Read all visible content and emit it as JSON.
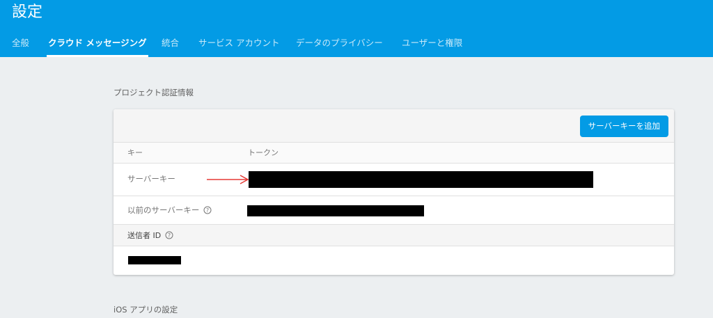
{
  "header": {
    "title": "設定",
    "tabs": [
      {
        "label": "全般",
        "active": false
      },
      {
        "label": "クラウド メッセージング",
        "active": true
      },
      {
        "label": "統合",
        "active": false
      },
      {
        "label": "サービス アカウント",
        "active": false
      },
      {
        "label": "データのプライバシー",
        "active": false
      },
      {
        "label": "ユーザーと権限",
        "active": false
      }
    ]
  },
  "credentials": {
    "heading": "プロジェクト認証情報",
    "add_key_button": "サーバーキーを追加",
    "columns": {
      "key": "キー",
      "token": "トークン"
    },
    "rows": [
      {
        "label": "サーバーキー",
        "token": "[redacted]"
      },
      {
        "label": "以前のサーバーキー",
        "token": "[redacted]",
        "help_icon": "help-circle-icon"
      }
    ],
    "sender_id_label": "送信者 ID",
    "sender_id_value": "[redacted]",
    "sender_help_icon": "help-circle-icon"
  },
  "ios_section": {
    "heading": "iOS アプリの設定"
  },
  "annotation": {
    "arrow_icon": "red-arrow-icon",
    "arrow_color": "#e53935"
  },
  "colors": {
    "header_bg": "#039be5",
    "button_bg": "#039be5",
    "page_bg": "#eceff1"
  }
}
